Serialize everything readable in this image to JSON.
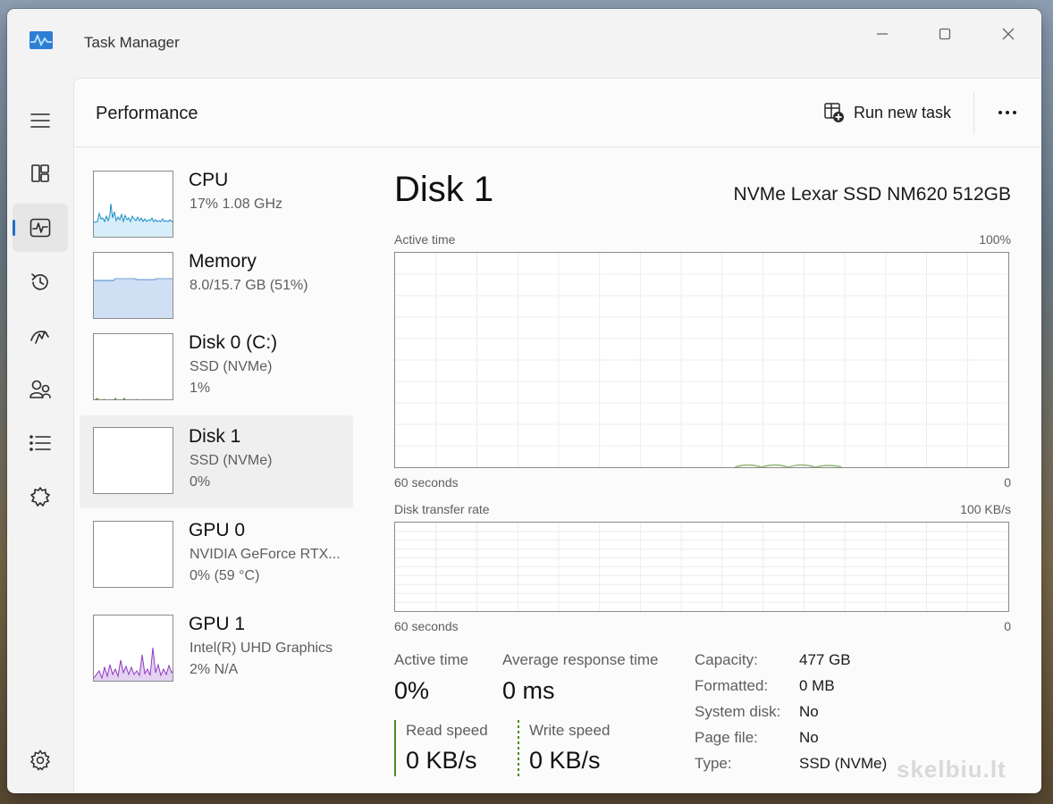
{
  "window": {
    "title": "Task Manager"
  },
  "header": {
    "page_title": "Performance",
    "run_task_label": "Run new task"
  },
  "nav": {
    "items": [
      {
        "icon": "hamburger-menu-icon"
      },
      {
        "icon": "processes-icon"
      },
      {
        "icon": "performance-icon",
        "active": true
      },
      {
        "icon": "app-history-icon"
      },
      {
        "icon": "startup-apps-icon"
      },
      {
        "icon": "users-icon"
      },
      {
        "icon": "details-icon"
      },
      {
        "icon": "services-icon"
      }
    ],
    "settings_icon": "settings-icon"
  },
  "devices": [
    {
      "name": "CPU",
      "line1": "17%  1.08 GHz",
      "line2": ""
    },
    {
      "name": "Memory",
      "line1": "8.0/15.7 GB (51%)",
      "line2": ""
    },
    {
      "name": "Disk 0 (C:)",
      "line1": "SSD (NVMe)",
      "line2": "1%"
    },
    {
      "name": "Disk 1",
      "line1": "SSD (NVMe)",
      "line2": "0%"
    },
    {
      "name": "GPU 0",
      "line1": "NVIDIA GeForce RTX...",
      "line2": "0% (59 °C)"
    },
    {
      "name": "GPU 1",
      "line1": "Intel(R) UHD Graphics",
      "line2": "2%  N/A"
    }
  ],
  "detail": {
    "title": "Disk 1",
    "model": "NVMe Lexar SSD NM620 512GB",
    "active_graph": {
      "label": "Active time",
      "max": "100%",
      "time": "60 seconds",
      "min": "0"
    },
    "transfer_graph": {
      "label": "Disk transfer rate",
      "max": "100 KB/s",
      "time": "60 seconds",
      "min": "0"
    },
    "stats": {
      "active_time_label": "Active time",
      "active_time_value": "0%",
      "avg_response_label": "Average response time",
      "avg_response_value": "0 ms",
      "read_label": "Read speed",
      "read_value": "0 KB/s",
      "write_label": "Write speed",
      "write_value": "0 KB/s"
    },
    "properties": [
      {
        "label": "Capacity:",
        "value": "477 GB"
      },
      {
        "label": "Formatted:",
        "value": "0 MB"
      },
      {
        "label": "System disk:",
        "value": "No"
      },
      {
        "label": "Page file:",
        "value": "No"
      },
      {
        "label": "Type:",
        "value": "SSD (NVMe)"
      }
    ]
  },
  "colors": {
    "cpu": "#1b8ec7",
    "memory": "#7da7d9",
    "disk": "#4d8a1f",
    "gpu": "#8e3ac1",
    "accent": "#1f6fc4"
  },
  "watermark": "skelbiu.lt"
}
